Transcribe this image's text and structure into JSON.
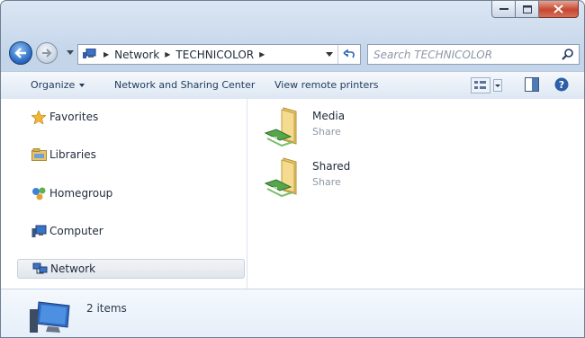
{
  "address": {
    "crumbs": [
      "Network",
      "TECHNICOLOR"
    ]
  },
  "search": {
    "placeholder": "Search TECHNICOLOR"
  },
  "toolbar": {
    "organize": "Organize",
    "network_sharing": "Network and Sharing Center",
    "view_printers": "View remote printers"
  },
  "nav": {
    "items": [
      {
        "label": "Favorites",
        "icon": "star-icon"
      },
      {
        "label": "Libraries",
        "icon": "libraries-icon"
      },
      {
        "label": "Homegroup",
        "icon": "homegroup-icon"
      },
      {
        "label": "Computer",
        "icon": "computer-icon"
      },
      {
        "label": "Network",
        "icon": "network-icon",
        "selected": true
      }
    ]
  },
  "files": [
    {
      "name": "Media",
      "type": "Share",
      "icon": "shared-folder-icon"
    },
    {
      "name": "Shared",
      "type": "Share",
      "icon": "shared-folder-icon"
    }
  ],
  "status": {
    "count": "2 items"
  },
  "colors": {
    "close_button": "#c7462f",
    "toolbar_text": "#1e395b",
    "selection_bg": "#e1e6ed"
  }
}
